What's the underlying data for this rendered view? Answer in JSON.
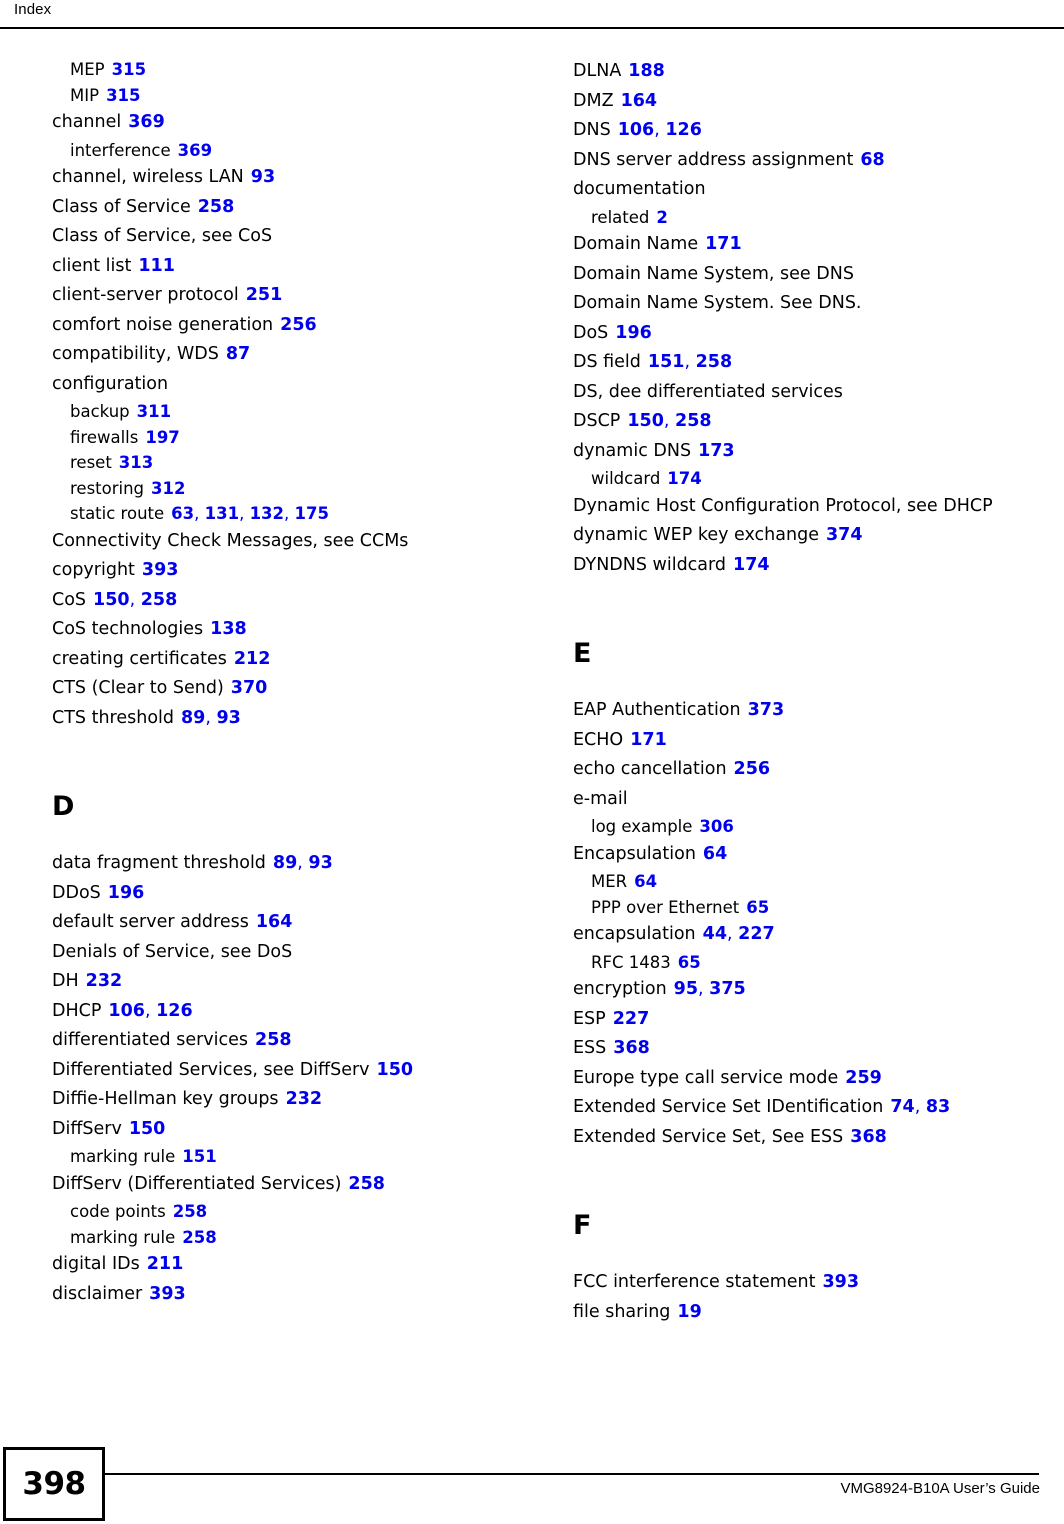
{
  "header": {
    "title": "Index"
  },
  "footer": {
    "page_number": "398",
    "guide_title": "VMG8924-B10A User’s Guide"
  },
  "colors": {
    "reference_blue": "#0000ee",
    "text_black": "#000000",
    "page_background": "#ffffff"
  },
  "columns": [
    {
      "name": "left-column",
      "blocks": [
        {
          "letter": "",
          "entries": [
            {
              "level": 1,
              "term": "MEP",
              "refs": [
                "315"
              ]
            },
            {
              "level": 1,
              "term": "MIP",
              "refs": [
                "315"
              ]
            },
            {
              "level": 0,
              "term": "channel",
              "refs": [
                "369"
              ]
            },
            {
              "level": 1,
              "term": "interference",
              "refs": [
                "369"
              ]
            },
            {
              "level": 0,
              "term": "channel, wireless LAN",
              "refs": [
                "93"
              ]
            },
            {
              "level": 0,
              "term": "Class of Service",
              "refs": [
                "258"
              ]
            },
            {
              "level": 0,
              "term": "Class of Service, see CoS",
              "refs": []
            },
            {
              "level": 0,
              "term": "client list",
              "refs": [
                "111"
              ]
            },
            {
              "level": 0,
              "term": "client-server protocol",
              "refs": [
                "251"
              ]
            },
            {
              "level": 0,
              "term": "comfort noise generation",
              "refs": [
                "256"
              ]
            },
            {
              "level": 0,
              "term": "compatibility, WDS",
              "refs": [
                "87"
              ]
            },
            {
              "level": 0,
              "term": "configuration",
              "refs": []
            },
            {
              "level": 1,
              "term": "backup",
              "refs": [
                "311"
              ]
            },
            {
              "level": 1,
              "term": "firewalls",
              "refs": [
                "197"
              ]
            },
            {
              "level": 1,
              "term": "reset",
              "refs": [
                "313"
              ]
            },
            {
              "level": 1,
              "term": "restoring",
              "refs": [
                "312"
              ]
            },
            {
              "level": 1,
              "term": "static route",
              "refs": [
                "63",
                "131",
                "132",
                "175"
              ]
            },
            {
              "level": 0,
              "term": "Connectivity Check Messages, see CCMs",
              "refs": []
            },
            {
              "level": 0,
              "term": "copyright",
              "refs": [
                "393"
              ]
            },
            {
              "level": 0,
              "term": "CoS",
              "refs": [
                "150",
                "258"
              ]
            },
            {
              "level": 0,
              "term": "CoS technologies",
              "refs": [
                "138"
              ]
            },
            {
              "level": 0,
              "term": "creating certificates",
              "refs": [
                "212"
              ]
            },
            {
              "level": 0,
              "term": "CTS (Clear to Send)",
              "refs": [
                "370"
              ]
            },
            {
              "level": 0,
              "term": "CTS threshold",
              "refs": [
                "89",
                "93"
              ]
            }
          ]
        },
        {
          "letter": "D",
          "entries": [
            {
              "level": 0,
              "term": "data fragment threshold",
              "refs": [
                "89",
                "93"
              ]
            },
            {
              "level": 0,
              "term": "DDoS",
              "refs": [
                "196"
              ]
            },
            {
              "level": 0,
              "term": "default server address",
              "refs": [
                "164"
              ]
            },
            {
              "level": 0,
              "term": "Denials of Service, see DoS",
              "refs": []
            },
            {
              "level": 0,
              "term": "DH",
              "refs": [
                "232"
              ]
            },
            {
              "level": 0,
              "term": "DHCP",
              "refs": [
                "106",
                "126"
              ]
            },
            {
              "level": 0,
              "term": "differentiated services",
              "refs": [
                "258"
              ]
            },
            {
              "level": 0,
              "term": "Differentiated Services, see DiffServ",
              "refs": [
                "150"
              ]
            },
            {
              "level": 0,
              "term": "Diffie-Hellman key groups",
              "refs": [
                "232"
              ]
            },
            {
              "level": 0,
              "term": "DiffServ",
              "refs": [
                "150"
              ]
            },
            {
              "level": 1,
              "term": "marking rule",
              "refs": [
                "151"
              ]
            },
            {
              "level": 0,
              "term": "DiffServ (Differentiated Services)",
              "refs": [
                "258"
              ]
            },
            {
              "level": 1,
              "term": "code points",
              "refs": [
                "258"
              ]
            },
            {
              "level": 1,
              "term": "marking rule",
              "refs": [
                "258"
              ]
            },
            {
              "level": 0,
              "term": "digital IDs",
              "refs": [
                "211"
              ]
            },
            {
              "level": 0,
              "term": "disclaimer",
              "refs": [
                "393"
              ]
            }
          ]
        }
      ]
    },
    {
      "name": "right-column",
      "blocks": [
        {
          "letter": "",
          "entries": [
            {
              "level": 0,
              "term": "DLNA",
              "refs": [
                "188"
              ]
            },
            {
              "level": 0,
              "term": "DMZ",
              "refs": [
                "164"
              ]
            },
            {
              "level": 0,
              "term": "DNS",
              "refs": [
                "106",
                "126"
              ]
            },
            {
              "level": 0,
              "term": "DNS server address assignment",
              "refs": [
                "68"
              ]
            },
            {
              "level": 0,
              "term": "documentation",
              "refs": []
            },
            {
              "level": 1,
              "term": "related",
              "refs": [
                "2"
              ]
            },
            {
              "level": 0,
              "term": "Domain Name",
              "refs": [
                "171"
              ]
            },
            {
              "level": 0,
              "term": "Domain Name System, see DNS",
              "refs": []
            },
            {
              "level": 0,
              "term": "Domain Name System. See DNS.",
              "refs": []
            },
            {
              "level": 0,
              "term": "DoS",
              "refs": [
                "196"
              ]
            },
            {
              "level": 0,
              "term": "DS field",
              "refs": [
                "151",
                "258"
              ]
            },
            {
              "level": 0,
              "term": "DS, dee differentiated services",
              "refs": []
            },
            {
              "level": 0,
              "term": "DSCP",
              "refs": [
                "150",
                "258"
              ]
            },
            {
              "level": 0,
              "term": "dynamic DNS",
              "refs": [
                "173"
              ]
            },
            {
              "level": 1,
              "term": "wildcard",
              "refs": [
                "174"
              ]
            },
            {
              "level": 0,
              "term": "Dynamic Host Configuration Protocol, see DHCP",
              "refs": []
            },
            {
              "level": 0,
              "term": "dynamic WEP key exchange",
              "refs": [
                "374"
              ]
            },
            {
              "level": 0,
              "term": "DYNDNS wildcard",
              "refs": [
                "174"
              ]
            }
          ]
        },
        {
          "letter": "E",
          "entries": [
            {
              "level": 0,
              "term": "EAP Authentication",
              "refs": [
                "373"
              ]
            },
            {
              "level": 0,
              "term": "ECHO",
              "refs": [
                "171"
              ]
            },
            {
              "level": 0,
              "term": "echo cancellation",
              "refs": [
                "256"
              ]
            },
            {
              "level": 0,
              "term": "e-mail",
              "refs": []
            },
            {
              "level": 1,
              "term": "log example",
              "refs": [
                "306"
              ]
            },
            {
              "level": 0,
              "term": "Encapsulation",
              "refs": [
                "64"
              ]
            },
            {
              "level": 1,
              "term": "MER",
              "refs": [
                "64"
              ]
            },
            {
              "level": 1,
              "term": "PPP over Ethernet",
              "refs": [
                "65"
              ]
            },
            {
              "level": 0,
              "term": "encapsulation",
              "refs": [
                "44",
                "227"
              ]
            },
            {
              "level": 1,
              "term": "RFC 1483",
              "refs": [
                "65"
              ]
            },
            {
              "level": 0,
              "term": "encryption",
              "refs": [
                "95",
                "375"
              ]
            },
            {
              "level": 0,
              "term": "ESP",
              "refs": [
                "227"
              ]
            },
            {
              "level": 0,
              "term": "ESS",
              "refs": [
                "368"
              ]
            },
            {
              "level": 0,
              "term": "Europe type call service mode",
              "refs": [
                "259"
              ]
            },
            {
              "level": 0,
              "term": "Extended Service Set IDentification",
              "refs": [
                "74",
                "83"
              ]
            },
            {
              "level": 0,
              "term": "Extended Service Set, See ESS",
              "refs": [
                "368"
              ]
            }
          ]
        },
        {
          "letter": "F",
          "entries": [
            {
              "level": 0,
              "term": "FCC interference statement",
              "refs": [
                "393"
              ]
            },
            {
              "level": 0,
              "term": "file sharing",
              "refs": [
                "19"
              ]
            }
          ]
        }
      ]
    }
  ]
}
